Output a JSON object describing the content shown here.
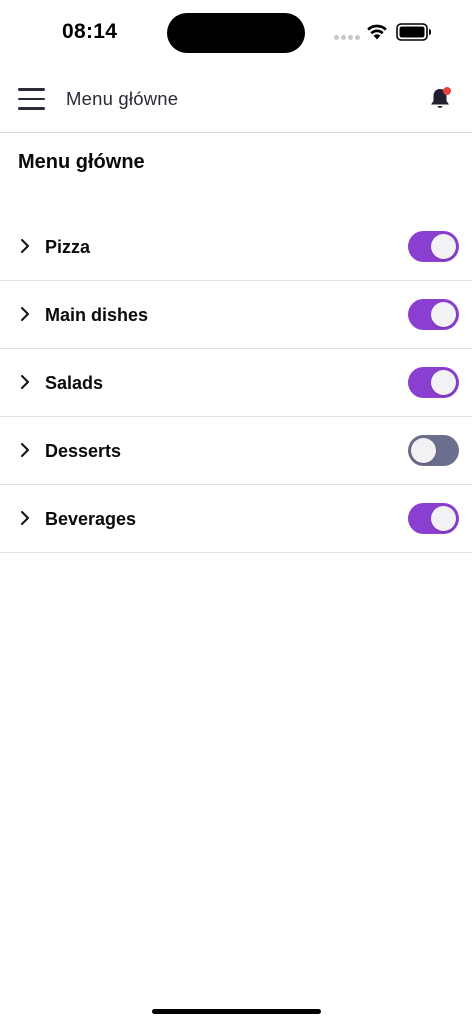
{
  "status_bar": {
    "time": "08:14"
  },
  "header": {
    "title": "Menu główne",
    "menu_icon": "hamburger-icon",
    "notification_icon": "bell-icon",
    "notification_dot_color": "#e8413c"
  },
  "page": {
    "title": "Menu główne"
  },
  "categories": [
    {
      "label": "Pizza",
      "enabled": true
    },
    {
      "label": "Main dishes",
      "enabled": true
    },
    {
      "label": "Salads",
      "enabled": true
    },
    {
      "label": "Desserts",
      "enabled": false
    },
    {
      "label": "Beverages",
      "enabled": true
    }
  ],
  "colors": {
    "toggle_on": "#8a3fd1",
    "toggle_off": "#6b6e8c"
  }
}
